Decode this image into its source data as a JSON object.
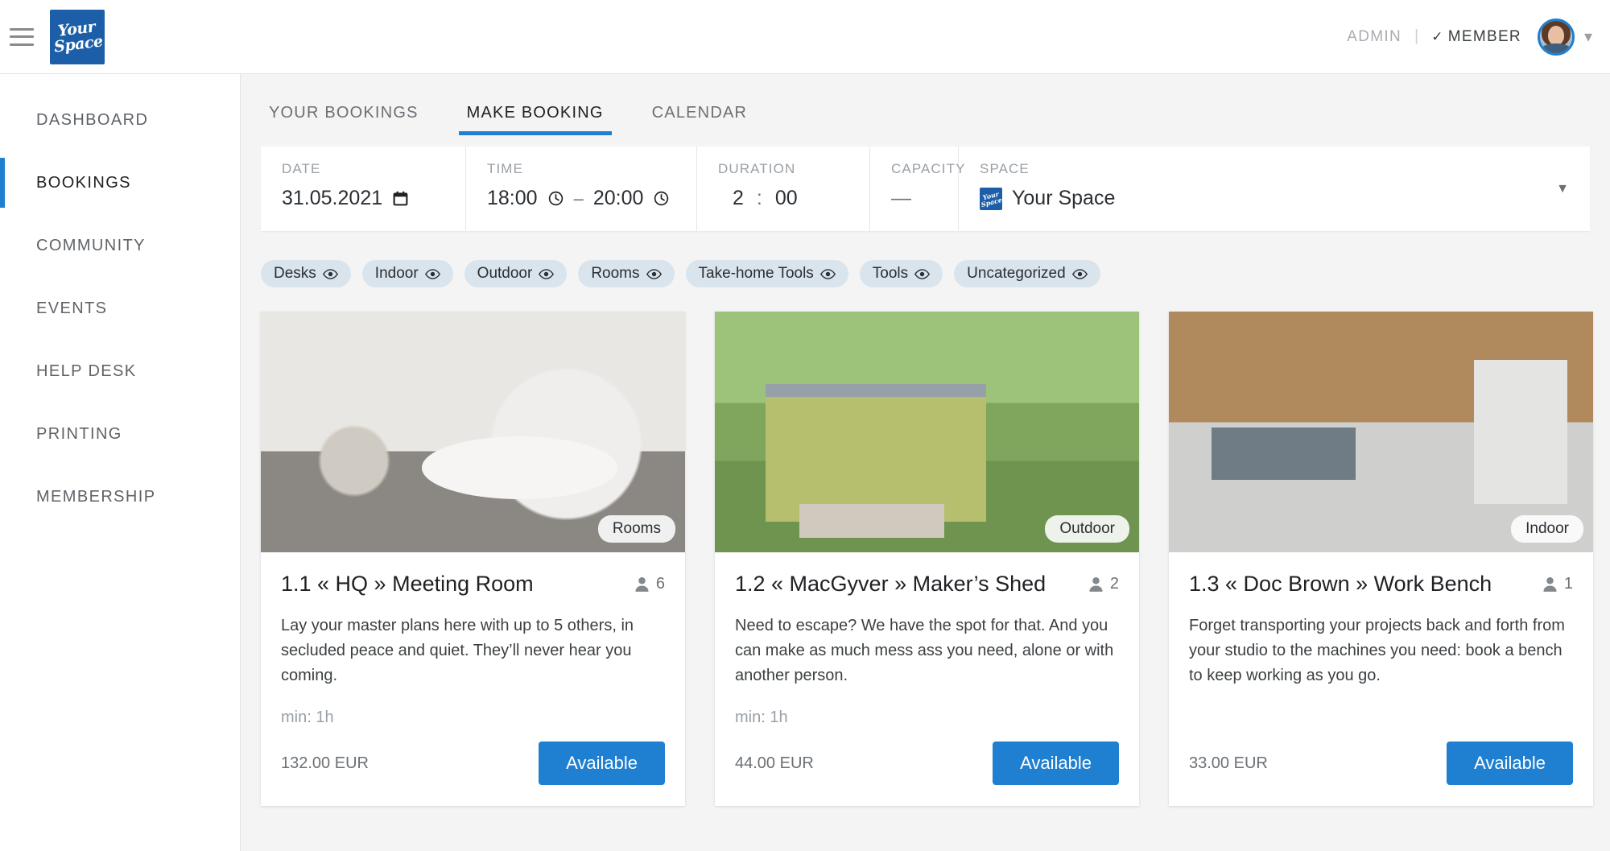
{
  "header": {
    "menu_icon": "hamburger-icon",
    "logo_line1": "Your",
    "logo_line2": "Space",
    "role_admin": "ADMIN",
    "role_separator": "|",
    "role_check": "✓",
    "role_member": "MEMBER",
    "avatar_icon": "user-avatar",
    "caret_icon": "chevron-down-icon"
  },
  "sidebar": {
    "items": [
      {
        "label": "DASHBOARD",
        "active": false
      },
      {
        "label": "BOOKINGS",
        "active": true
      },
      {
        "label": "COMMUNITY",
        "active": false
      },
      {
        "label": "EVENTS",
        "active": false
      },
      {
        "label": "HELP DESK",
        "active": false
      },
      {
        "label": "PRINTING",
        "active": false
      },
      {
        "label": "MEMBERSHIP",
        "active": false
      }
    ]
  },
  "tabs": [
    {
      "label": "YOUR BOOKINGS",
      "active": false
    },
    {
      "label": "MAKE BOOKING",
      "active": true
    },
    {
      "label": "CALENDAR",
      "active": false
    }
  ],
  "booking_bar": {
    "date": {
      "label": "DATE",
      "value": "31.05.2021",
      "icon": "calendar-icon"
    },
    "time": {
      "label": "TIME",
      "start": "18:00",
      "separator": "–",
      "end": "20:00",
      "start_icon": "clock-icon",
      "end_icon": "clock-icon"
    },
    "duration": {
      "label": "DURATION",
      "hours": "2",
      "colon": ":",
      "minutes": "00"
    },
    "capacity": {
      "label": "CAPACITY",
      "value": "—"
    },
    "space": {
      "label": "SPACE",
      "value": "Your Space",
      "logo_line1": "Your",
      "logo_line2": "Space",
      "caret_icon": "chevron-down-icon"
    }
  },
  "filters": [
    {
      "label": "Desks",
      "icon": "eye-icon"
    },
    {
      "label": "Indoor",
      "icon": "eye-icon"
    },
    {
      "label": "Outdoor",
      "icon": "eye-icon"
    },
    {
      "label": "Rooms",
      "icon": "eye-icon"
    },
    {
      "label": "Take-home Tools",
      "icon": "eye-icon"
    },
    {
      "label": "Tools",
      "icon": "eye-icon"
    },
    {
      "label": "Uncategorized",
      "icon": "eye-icon"
    }
  ],
  "cards": [
    {
      "badge": "Rooms",
      "title": "1.1 « HQ » Meeting Room",
      "capacity": "6",
      "description": "Lay your master plans here with up to 5 others, in secluded peace and quiet. They’ll never hear you coming.",
      "min": "min: 1h",
      "price": "132.00 EUR",
      "action": "Available",
      "image": "meeting-room-photo"
    },
    {
      "badge": "Outdoor",
      "title": "1.2 « MacGyver » Maker’s Shed",
      "capacity": "2",
      "description": "Need to escape? We have the spot for that. And you can make as much mess ass you need, alone or with another person.",
      "min": "min: 1h",
      "price": "44.00 EUR",
      "action": "Available",
      "image": "maker-shed-photo"
    },
    {
      "badge": "Indoor",
      "title": "1.3 « Doc Brown » Work Bench",
      "capacity": "1",
      "description": "Forget transporting your projects back and forth from your studio to the machines you need: book a bench to keep working as you go.",
      "min": "",
      "price": "33.00 EUR",
      "action": "Available",
      "image": "workshop-photo"
    }
  ],
  "colors": {
    "brand_blue": "#1c5fa8",
    "accent_blue": "#1f7fd0",
    "page_bg": "#f4f4f4",
    "chip_bg": "#d9e4ec"
  }
}
